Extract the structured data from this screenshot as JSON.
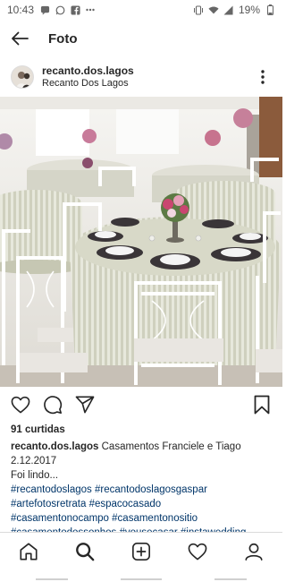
{
  "status_bar": {
    "time": "10:43",
    "battery": "19%",
    "left_icons": [
      "chat-icon",
      "whatsapp-icon",
      "facebook-icon",
      "more-dots-icon"
    ],
    "right_icons": [
      "vibrate-icon",
      "wifi-icon",
      "signal-icon",
      "battery-icon"
    ]
  },
  "app_bar": {
    "title": "Foto"
  },
  "post": {
    "username": "recanto.dos.lagos",
    "location": "Recanto Dos Lagos",
    "likes": "91 curtidas",
    "caption_text": "Casamentos Franciele e Tiago",
    "caption_line2": "2.12.2017",
    "caption_line3": "Foi lindo...",
    "hashtags": [
      "#recantodoslagos #recantodoslagosgaspar",
      "#artefotosretrata #espacocasado",
      "#casamentonocampo #casamentonositio",
      "#casamentodossonhos #vousecasar #instawedding"
    ],
    "photo_subject": "wedding reception tables with striped tablecloths, white chairs and flower centerpieces"
  },
  "colors": {
    "text": "#262626",
    "hashtag": "#003569",
    "divider": "#dbdbdb"
  },
  "bottom_nav": [
    "home-icon",
    "search-icon",
    "add-post-icon",
    "activity-heart-icon",
    "profile-icon"
  ]
}
